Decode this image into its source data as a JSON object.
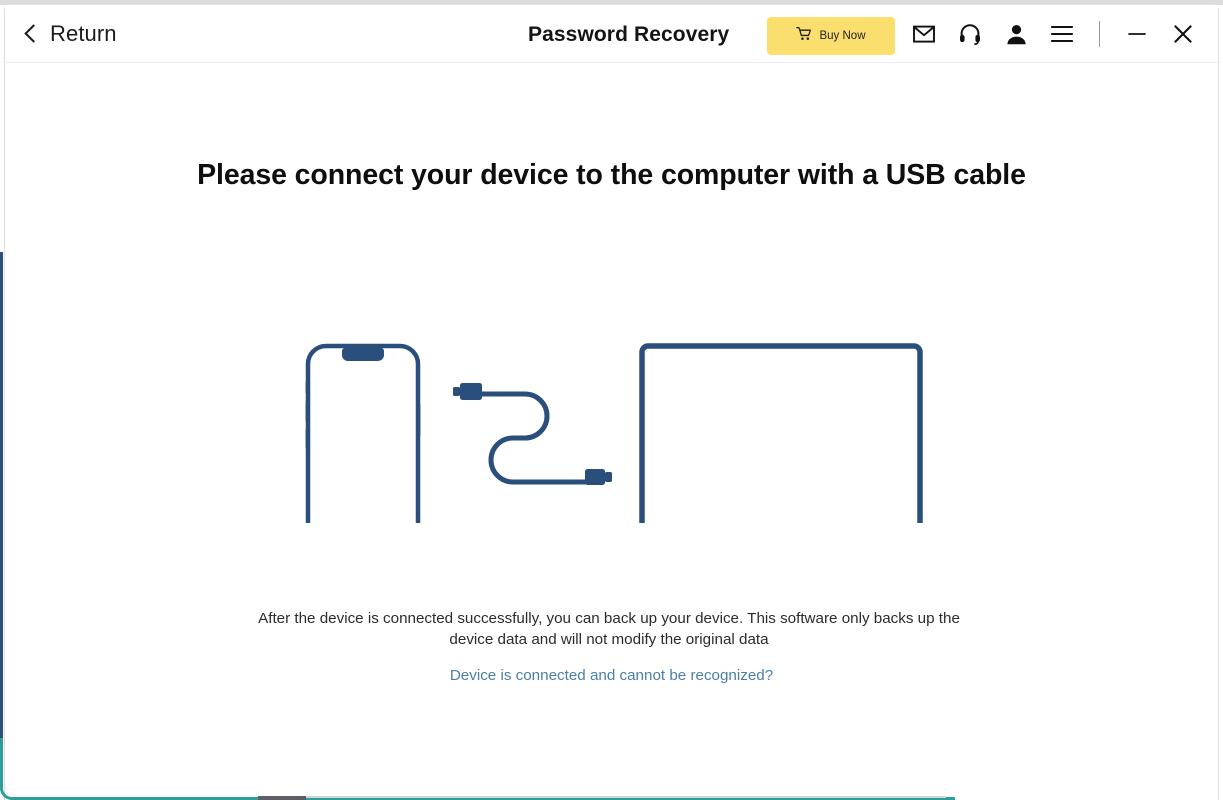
{
  "window": {
    "accent_blue": "#2a4f7c",
    "accent_teal": "#2f9e9b",
    "buy_now_bg": "#fade6e",
    "link_color": "#4a7fa6"
  },
  "titlebar": {
    "back_label": "Return",
    "back_icon": "chevron-left-icon",
    "title": "Password Recovery",
    "buy_now_label": "Buy Now",
    "buy_now_icon": "shopping-cart-icon",
    "icons": [
      {
        "name": "mail-icon",
        "label": "Mail"
      },
      {
        "name": "headset-icon",
        "label": "Support"
      },
      {
        "name": "user-icon",
        "label": "Account"
      },
      {
        "name": "hamburger-menu-icon",
        "label": "Menu"
      }
    ],
    "minimize_label": "Minimize",
    "minimize_icon": "minimize-icon",
    "close_label": "Close",
    "close_icon": "close-icon"
  },
  "main": {
    "headline": "Please connect your device to the computer with a USB cable",
    "illustration": {
      "name": "phone-usb-cable-monitor-illustration",
      "phone": "smartphone-icon",
      "cable": "usb-cable-icon",
      "monitor": "desktop-monitor-icon"
    },
    "description": "After the device is connected successfully, you can back up your device. This software only backs up the device data and will not modify the original data",
    "help_link": "Device is connected and cannot be recognized?"
  }
}
